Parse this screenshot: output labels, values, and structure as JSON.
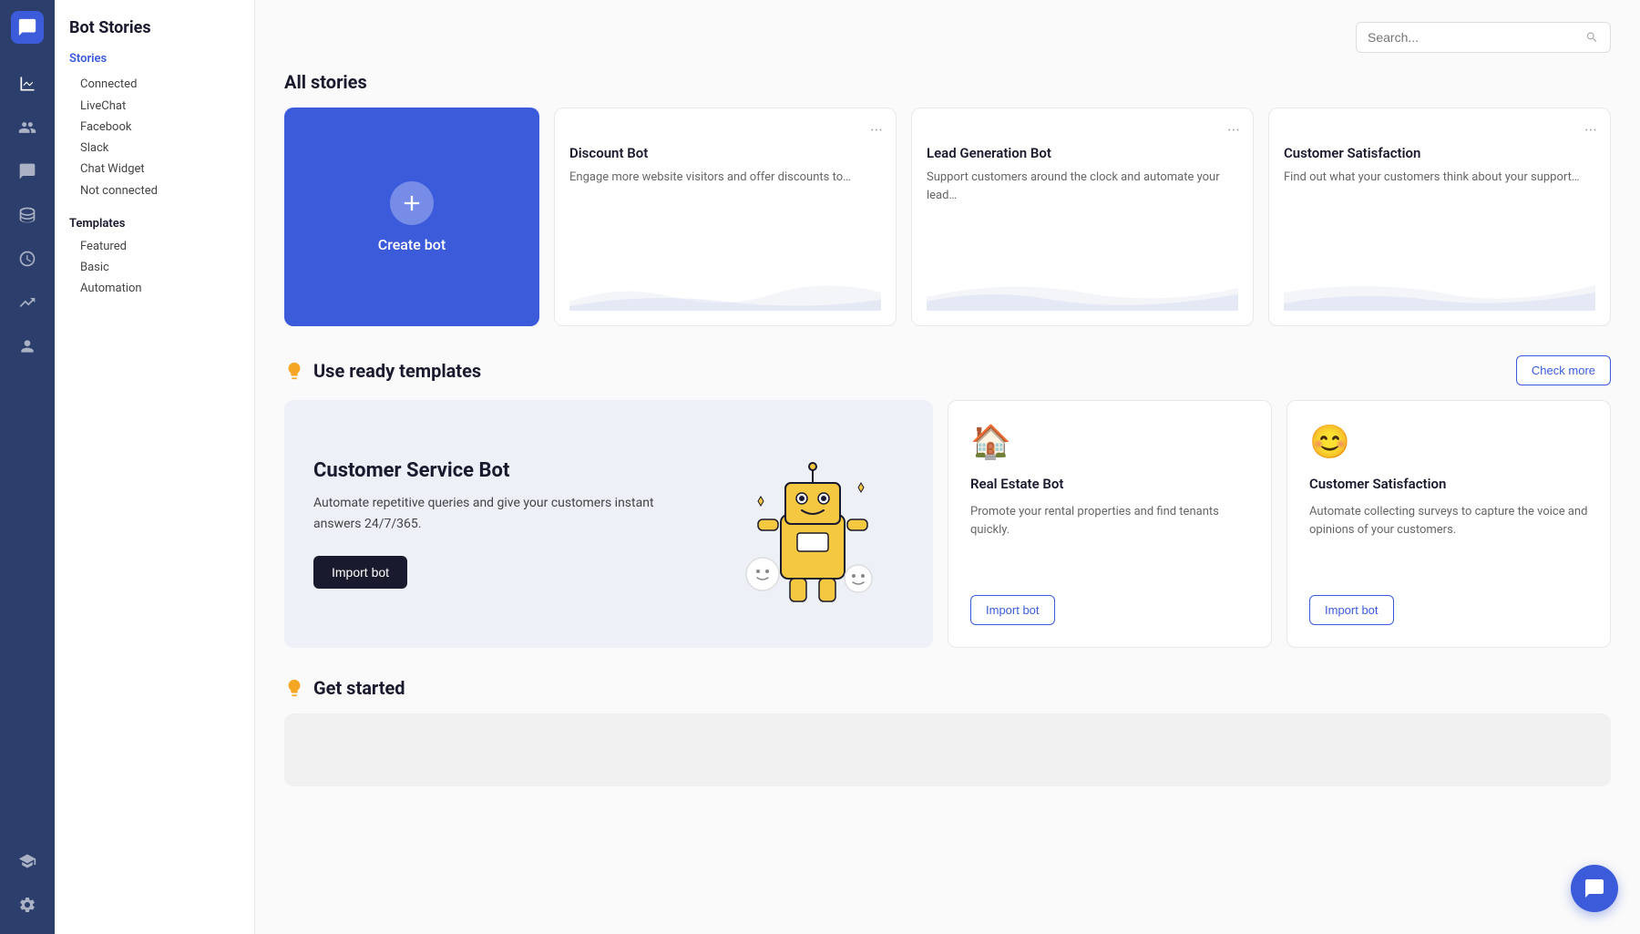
{
  "app": {
    "title": "Bot Stories"
  },
  "search": {
    "placeholder": "Search..."
  },
  "sidebar": {
    "title": "Bot Stories",
    "stories_label": "Stories",
    "connected_label": "Connected",
    "connected_items": [
      "LiveChat",
      "Facebook",
      "Slack",
      "Chat Widget"
    ],
    "not_connected_label": "Not connected",
    "templates_label": "Templates",
    "template_items": [
      "Featured",
      "Basic",
      "Automation"
    ]
  },
  "allStories": {
    "section_title": "All stories",
    "create_bot_label": "Create bot",
    "cards": [
      {
        "title": "Discount Bot",
        "description": "Engage more website visitors and offer discounts to…"
      },
      {
        "title": "Lead Generation Bot",
        "description": "Support customers around the clock and automate your lead…"
      },
      {
        "title": "Customer Satisfaction",
        "description": "Find out what your customers think about your support…"
      }
    ]
  },
  "templates": {
    "section_title": "Use ready templates",
    "check_more_label": "Check more",
    "featured": {
      "title": "Customer Service Bot",
      "description": "Automate repetitive queries and give your customers instant answers 24/7/365.",
      "import_label": "Import bot"
    },
    "small_cards": [
      {
        "icon": "🏠",
        "title": "Real Estate Bot",
        "description": "Promote your rental properties and find tenants quickly.",
        "import_label": "Import bot"
      },
      {
        "icon": "😊",
        "title": "Customer Satisfaction",
        "description": "Automate collecting surveys to capture the voice and opinions of your customers.",
        "import_label": "Import bot"
      }
    ]
  },
  "getStarted": {
    "section_title": "Get started"
  },
  "icons": {
    "logo": "💬",
    "analytics": "📊",
    "contacts": "👥",
    "chat": "💬",
    "database": "🗄",
    "clock": "🕐",
    "trend": "📈",
    "group": "👥",
    "school": "🎓",
    "settings": "⚙",
    "search": "🔍",
    "lightbulb": "💡",
    "menu_dots": "···"
  }
}
